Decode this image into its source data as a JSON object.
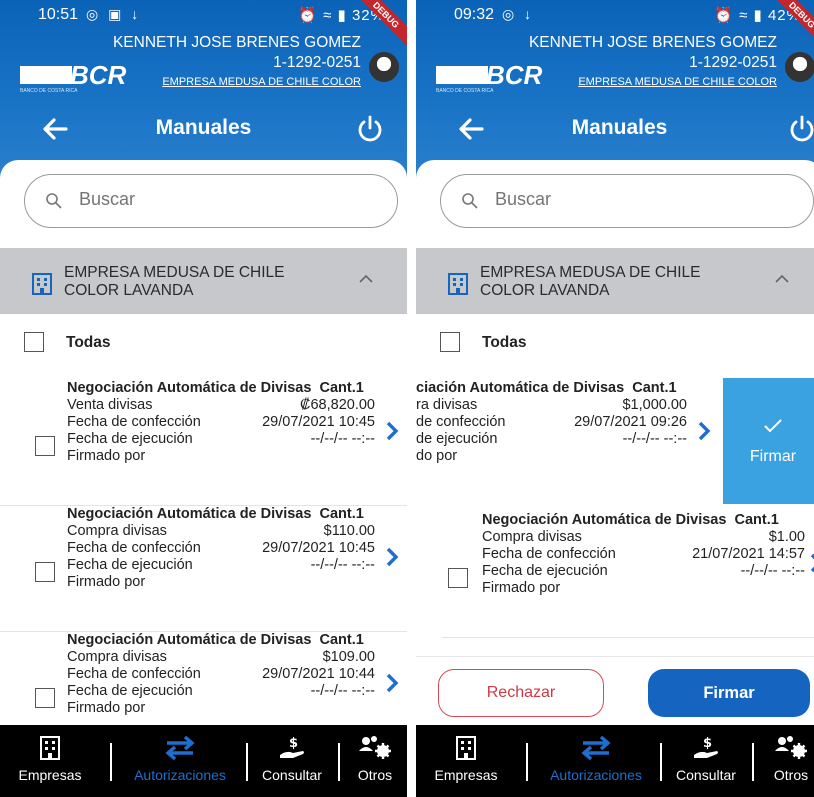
{
  "screens": {
    "left": {
      "status": {
        "time": "10:51",
        "icons_left": "◎ ▣ ↓",
        "battery": "32%",
        "debug": "DEBUG"
      },
      "header": {
        "logo": "BCR",
        "logo_sub": "BANCO DE COSTA RICA",
        "user_name": "KENNETH JOSE BRENES GOMEZ",
        "user_id": "1-1292-0251",
        "company": "EMPRESA MEDUSA DE CHILE COLOR",
        "title": "Manuales"
      },
      "search": {
        "placeholder": "Buscar"
      },
      "group": {
        "line1": "EMPRESA MEDUSA DE CHILE",
        "line2": "COLOR LAVANDA"
      },
      "select_all": "Todas",
      "items": [
        {
          "title": "Negociación Automática de Divisas",
          "qty": "Cant.1",
          "type": "Venta divisas",
          "amount": "₡68,820.00",
          "created_label": "Fecha de confección",
          "created": "29/07/2021 10:45",
          "exec_label": "Fecha de ejecución",
          "exec": "--/--/-- --:--",
          "signed_label": "Firmado por"
        },
        {
          "title": "Negociación Automática de Divisas",
          "qty": "Cant.1",
          "type": "Compra divisas",
          "amount": "$110.00",
          "created_label": "Fecha de confección",
          "created": "29/07/2021 10:45",
          "exec_label": "Fecha de ejecución",
          "exec": "--/--/-- --:--",
          "signed_label": "Firmado por"
        },
        {
          "title": "Negociación Automática de Divisas",
          "qty": "Cant.1",
          "type": "Compra divisas",
          "amount": "$109.00",
          "created_label": "Fecha de confección",
          "created": "29/07/2021 10:44",
          "exec_label": "Fecha de ejecución",
          "exec": "--/--/-- --:--",
          "signed_label": "Firmado por"
        }
      ]
    },
    "right": {
      "status": {
        "time": "09:32",
        "icons_left": "◎ ↓",
        "battery": "42%",
        "debug": "DEBUG"
      },
      "header": {
        "logo": "BCR",
        "logo_sub": "BANCO DE COSTA RICA",
        "user_name": "KENNETH JOSE BRENES GOMEZ",
        "user_id": "1-1292-0251",
        "company": "EMPRESA MEDUSA DE CHILE COLOR",
        "title": "Manuales"
      },
      "search": {
        "placeholder": "Buscar"
      },
      "group": {
        "line1": "EMPRESA MEDUSA DE CHILE",
        "line2": "COLOR LAVANDA"
      },
      "select_all": "Todas",
      "swiped_item": {
        "title": "ciación Automática de Divisas",
        "qty": "Cant.1",
        "type": "ra divisas",
        "amount": "$1,000.00",
        "created_label": "de confección",
        "created": "29/07/2021 09:26",
        "exec_label": "de ejecución",
        "exec": "--/--/-- --:--",
        "signed_label": "do por"
      },
      "swipe_action": "Firmar",
      "item2": {
        "title": "Negociación Automática de Divisas",
        "qty": "Cant.1",
        "type": "Compra divisas",
        "amount": "$1.00",
        "created_label": "Fecha de confección",
        "created": "21/07/2021 14:57",
        "exec_label": "Fecha de ejecución",
        "exec": "--/--/-- --:--",
        "signed_label": "Firmado por"
      },
      "actions": {
        "reject": "Rechazar",
        "sign": "Firmar"
      }
    }
  },
  "bottom_nav": {
    "empresas": "Empresas",
    "autorizaciones": "Autorizaciones",
    "consultar": "Consultar",
    "otros": "Otros"
  },
  "colors": {
    "header_blue": "#0b63b8",
    "accent_blue": "#1565c0",
    "swipe_blue": "#3aa2e0",
    "reject_red": "#d03844",
    "active_nav": "#1e6fd0"
  }
}
